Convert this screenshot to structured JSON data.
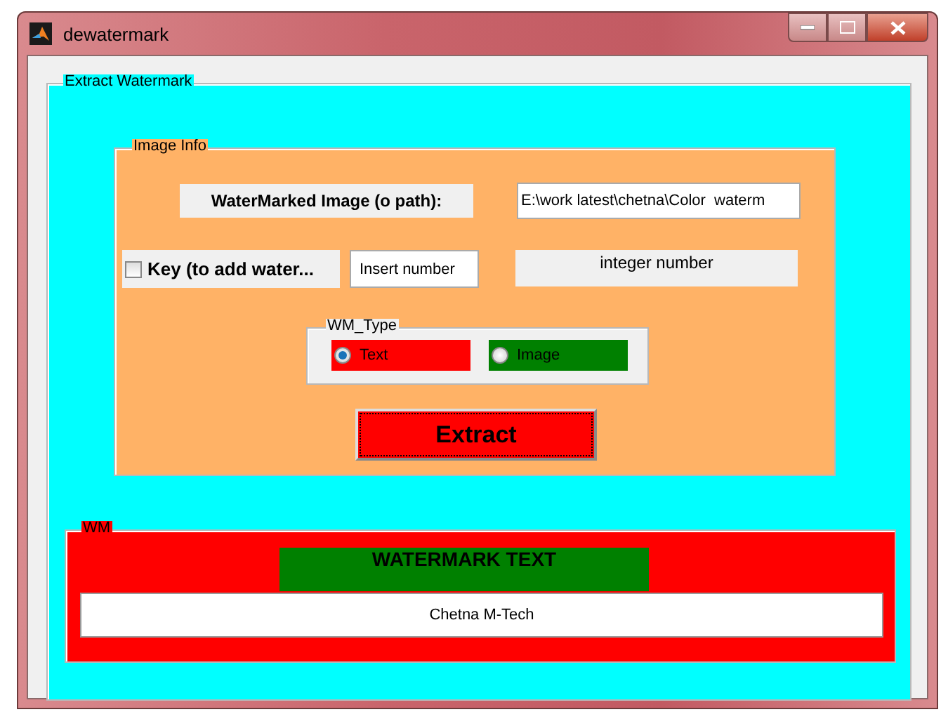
{
  "window": {
    "title": "dewatermark"
  },
  "extract_panel": {
    "title": "Extract Watermark"
  },
  "image_info": {
    "title": "Image Info",
    "path_label": "WaterMarked Image (o path):",
    "path_value": "E:\\work latest\\chetna\\Color  waterm",
    "key": {
      "label": "Key (to add water...",
      "checked": false
    },
    "key_field": {
      "value": "Insert number"
    },
    "key_hint": "integer number",
    "wm_type": {
      "title": "WM_Type",
      "options": [
        {
          "label": "Text",
          "selected": true,
          "color": "#ff0000"
        },
        {
          "label": "Image",
          "selected": false,
          "color": "#008000"
        }
      ]
    },
    "extract_button": "Extract"
  },
  "wm_panel": {
    "title": "WM",
    "heading": "WATERMARK TEXT",
    "value": "Chetna M-Tech"
  }
}
